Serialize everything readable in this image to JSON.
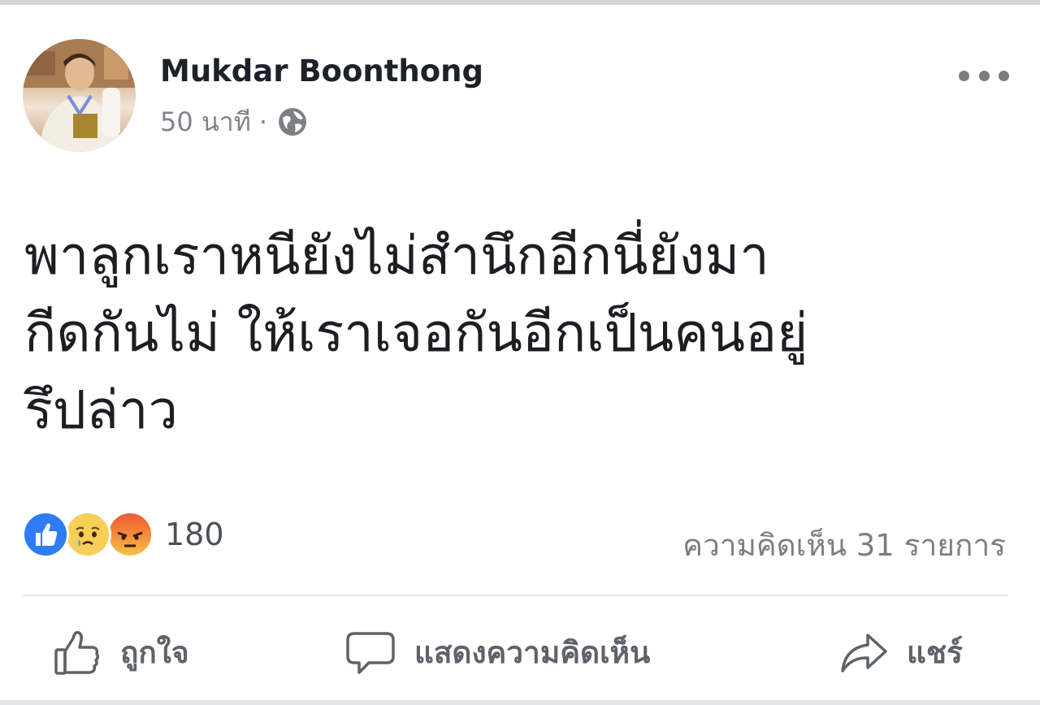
{
  "post": {
    "author": "Mukdar Boonthong",
    "time": "50 นาที",
    "separator": "·",
    "privacy_icon": "globe-icon",
    "more_icon": "more-dots-icon",
    "text_lines": [
      "พาลูกเราหนียังไม่สำนึกอีกนี่ยังมา",
      "กีดกันไม่ ให้เราเจอกันอีกเป็นคนอยู่",
      "รึปล่าว"
    ]
  },
  "reactions": {
    "types": [
      "like-icon",
      "sad-icon",
      "angry-icon"
    ],
    "count": "180",
    "comments": "ความคิดเห็น 31 รายการ"
  },
  "actions": {
    "like": "ถูกใจ",
    "comment": "แสดงความคิดเห็น",
    "share": "แชร์"
  },
  "colors": {
    "like_blue": "#2e7cf6",
    "text": "#1c1e21",
    "secondary": "#7f8389"
  }
}
